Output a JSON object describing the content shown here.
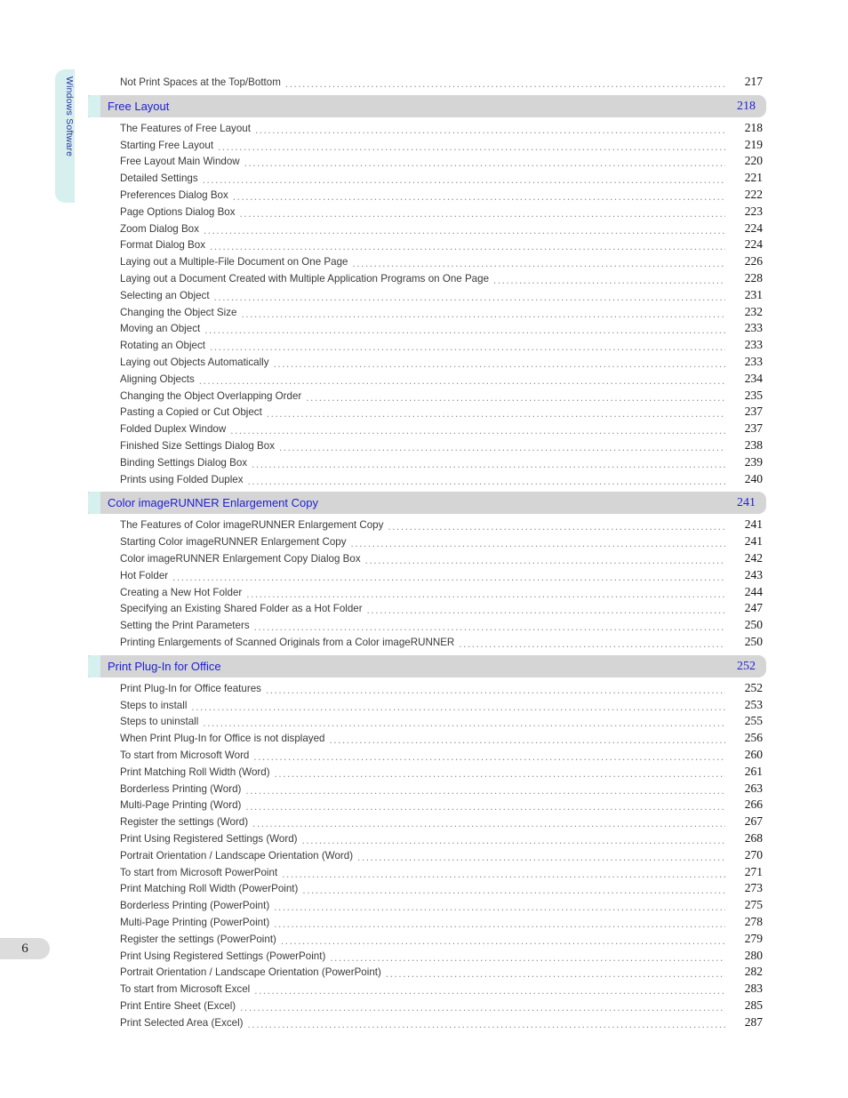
{
  "page": {
    "folio": "6",
    "side_tab_label": "Windows Software",
    "colors": {
      "section_bar": "#d5d5d5",
      "section_cap": "#d6f0ef",
      "section_text": "#2020d8",
      "entry_text": "#3b3b3b",
      "leader_dots": "#8a8a8a",
      "side_tab": "#d6f0ef",
      "side_tab_text": "#2b2f9e",
      "folio_chip": "#dcdcdc"
    }
  },
  "toc": {
    "blocks": [
      {
        "type": "entry",
        "title": "Not Print Spaces at the Top/Bottom",
        "page": "217"
      },
      {
        "type": "section",
        "title": "Free Layout",
        "page": "218"
      },
      {
        "type": "entry",
        "title": "The Features of Free Layout",
        "page": "218"
      },
      {
        "type": "entry",
        "title": "Starting Free Layout",
        "page": "219"
      },
      {
        "type": "entry",
        "title": "Free Layout Main Window",
        "page": "220"
      },
      {
        "type": "entry",
        "title": "Detailed Settings",
        "page": "221"
      },
      {
        "type": "entry",
        "title": "Preferences Dialog Box",
        "page": "222"
      },
      {
        "type": "entry",
        "title": "Page Options Dialog Box",
        "page": "223"
      },
      {
        "type": "entry",
        "title": "Zoom Dialog Box",
        "page": "224"
      },
      {
        "type": "entry",
        "title": "Format Dialog Box",
        "page": "224"
      },
      {
        "type": "entry",
        "title": "Laying out a Multiple-File Document on One Page",
        "page": "226"
      },
      {
        "type": "entry",
        "title": "Laying out a Document Created with Multiple Application Programs on One Page",
        "page": "228"
      },
      {
        "type": "entry",
        "title": "Selecting an Object",
        "page": "231"
      },
      {
        "type": "entry",
        "title": "Changing the Object Size",
        "page": "232"
      },
      {
        "type": "entry",
        "title": "Moving an Object",
        "page": "233"
      },
      {
        "type": "entry",
        "title": "Rotating an Object",
        "page": "233"
      },
      {
        "type": "entry",
        "title": "Laying out Objects Automatically",
        "page": "233"
      },
      {
        "type": "entry",
        "title": "Aligning Objects",
        "page": "234"
      },
      {
        "type": "entry",
        "title": "Changing the Object Overlapping Order",
        "page": "235"
      },
      {
        "type": "entry",
        "title": "Pasting a Copied or Cut Object",
        "page": "237"
      },
      {
        "type": "entry",
        "title": "Folded Duplex Window",
        "page": "237"
      },
      {
        "type": "entry",
        "title": "Finished Size Settings Dialog Box",
        "page": "238"
      },
      {
        "type": "entry",
        "title": "Binding Settings Dialog Box",
        "page": "239"
      },
      {
        "type": "entry",
        "title": "Prints using Folded Duplex",
        "page": "240"
      },
      {
        "type": "section",
        "title": "Color imageRUNNER Enlargement Copy",
        "page": "241"
      },
      {
        "type": "entry",
        "title": "The Features of Color imageRUNNER Enlargement Copy",
        "page": "241"
      },
      {
        "type": "entry",
        "title": "Starting Color imageRUNNER Enlargement Copy",
        "page": "241"
      },
      {
        "type": "entry",
        "title": "Color imageRUNNER Enlargement Copy Dialog Box",
        "page": "242"
      },
      {
        "type": "entry",
        "title": "Hot Folder",
        "page": "243"
      },
      {
        "type": "entry",
        "title": "Creating a New Hot Folder",
        "page": "244"
      },
      {
        "type": "entry",
        "title": "Specifying an Existing Shared Folder as a Hot Folder",
        "page": "247"
      },
      {
        "type": "entry",
        "title": "Setting the Print Parameters",
        "page": "250"
      },
      {
        "type": "entry",
        "title": "Printing Enlargements of Scanned Originals from a Color imageRUNNER",
        "page": "250"
      },
      {
        "type": "section",
        "title": "Print Plug-In for Office",
        "page": "252"
      },
      {
        "type": "entry",
        "title": "Print Plug-In for Office features",
        "page": "252"
      },
      {
        "type": "entry",
        "title": "Steps to install",
        "page": "253"
      },
      {
        "type": "entry",
        "title": "Steps to uninstall",
        "page": "255"
      },
      {
        "type": "entry",
        "title": "When Print Plug-In for Office is not displayed",
        "page": "256"
      },
      {
        "type": "entry",
        "title": "To start from Microsoft Word",
        "page": "260"
      },
      {
        "type": "entry",
        "title": "Print Matching Roll Width (Word)",
        "page": "261"
      },
      {
        "type": "entry",
        "title": "Borderless Printing (Word)",
        "page": "263"
      },
      {
        "type": "entry",
        "title": "Multi-Page Printing (Word)",
        "page": "266"
      },
      {
        "type": "entry",
        "title": "Register the settings (Word)",
        "page": "267"
      },
      {
        "type": "entry",
        "title": "Print Using Registered Settings (Word)",
        "page": "268"
      },
      {
        "type": "entry",
        "title": "Portrait Orientation / Landscape Orientation (Word)",
        "page": "270"
      },
      {
        "type": "entry",
        "title": "To start from Microsoft PowerPoint",
        "page": "271"
      },
      {
        "type": "entry",
        "title": "Print Matching Roll Width (PowerPoint)",
        "page": "273"
      },
      {
        "type": "entry",
        "title": "Borderless Printing (PowerPoint)",
        "page": "275"
      },
      {
        "type": "entry",
        "title": "Multi-Page Printing (PowerPoint)",
        "page": "278"
      },
      {
        "type": "entry",
        "title": "Register the settings (PowerPoint)",
        "page": "279"
      },
      {
        "type": "entry",
        "title": "Print Using Registered Settings (PowerPoint)",
        "page": "280"
      },
      {
        "type": "entry",
        "title": "Portrait Orientation / Landscape Orientation (PowerPoint)",
        "page": "282"
      },
      {
        "type": "entry",
        "title": "To start from Microsoft Excel",
        "page": "283"
      },
      {
        "type": "entry",
        "title": "Print Entire Sheet (Excel)",
        "page": "285"
      },
      {
        "type": "entry",
        "title": "Print Selected Area (Excel)",
        "page": "287"
      }
    ]
  }
}
